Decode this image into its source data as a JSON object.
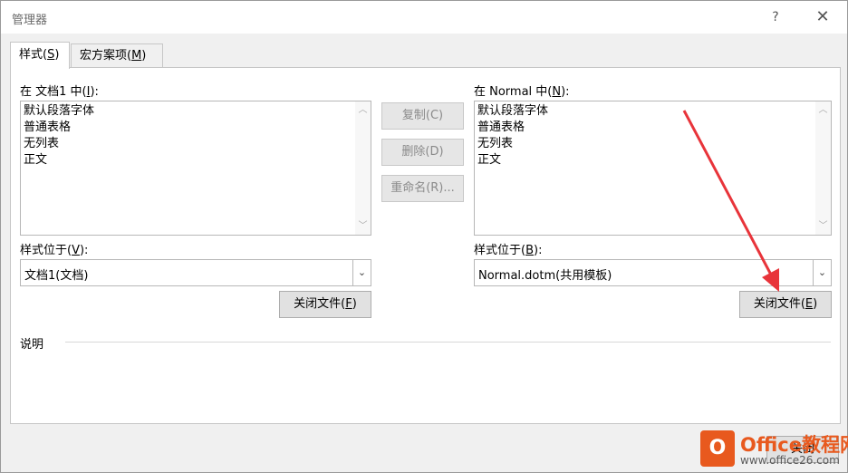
{
  "window": {
    "title": "管理器",
    "help_glyph": "?",
    "close_glyph": "✕"
  },
  "tabs": [
    {
      "label_pre": "样式(",
      "key": "S",
      "label_post": ")"
    },
    {
      "label_pre": "宏方案项(",
      "key": "M",
      "label_post": ")"
    }
  ],
  "left": {
    "header_pre": "在 文档1 中(",
    "header_key": "I",
    "header_post": "):",
    "items": [
      "默认段落字体",
      "普通表格",
      "无列表",
      "正文"
    ],
    "location_label_pre": "样式位于(",
    "location_key": "V",
    "location_label_post": "):",
    "location_value": "文档1(文档)",
    "close_file_pre": "关闭文件(",
    "close_file_key": "F",
    "close_file_post": ")"
  },
  "right": {
    "header_pre": "在 Normal 中(",
    "header_key": "N",
    "header_post": "):",
    "items": [
      "默认段落字体",
      "普通表格",
      "无列表",
      "正文"
    ],
    "location_label_pre": "样式位于(",
    "location_key": "B",
    "location_label_post": "):",
    "location_value": "Normal.dotm(共用模板)",
    "close_file_pre": "关闭文件(",
    "close_file_key": "E",
    "close_file_post": ")"
  },
  "middle": {
    "copy": "复制(C)",
    "delete": "删除(D)",
    "rename": "重命名(R)..."
  },
  "description_label": "说明",
  "bottom_button": "关闭",
  "watermark": {
    "logo_letter": "O",
    "line1": "Office教程网",
    "line2": "www.office26.com"
  },
  "colors": {
    "annotation_arrow": "#e8343a",
    "watermark": "#e8591e"
  }
}
